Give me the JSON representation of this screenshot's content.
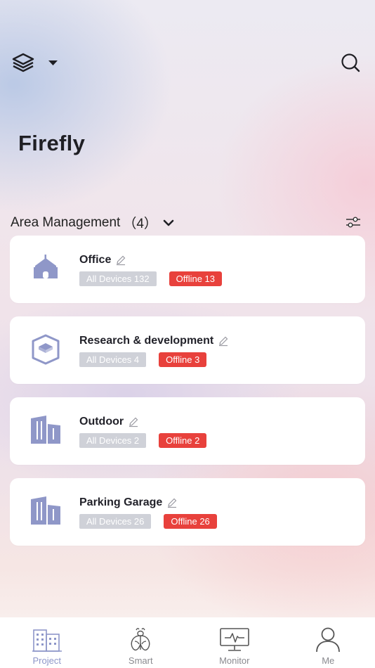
{
  "header": {
    "layers_icon": "layers-icon",
    "dropdown_icon": "caret-down-icon",
    "search_icon": "search-icon"
  },
  "title": "Firefly",
  "area_section": {
    "label": "Area Management",
    "count": "（4）",
    "chevron_icon": "chevron-down-icon",
    "filter_icon": "sliders-icon"
  },
  "areas": [
    {
      "name": "Office",
      "icon": "office-building-icon",
      "all_devices": "All Devices 132",
      "offline": "Offline 13"
    },
    {
      "name": "Research & development",
      "icon": "hexagon-cube-icon",
      "all_devices": "All Devices 4",
      "offline": "Offline 3"
    },
    {
      "name": "Outdoor",
      "icon": "buildings-icon",
      "all_devices": "All Devices 2",
      "offline": "Offline 2"
    },
    {
      "name": "Parking Garage",
      "icon": "buildings-icon",
      "all_devices": "All Devices 26",
      "offline": "Offline 26"
    }
  ],
  "tabs": [
    {
      "label": "Project",
      "icon": "building-icon",
      "active": true
    },
    {
      "label": "Smart",
      "icon": "firefly-icon",
      "active": false
    },
    {
      "label": "Monitor",
      "icon": "monitor-icon",
      "active": false
    },
    {
      "label": "Me",
      "icon": "person-icon",
      "active": false
    }
  ],
  "colors": {
    "accent": "#8d96c9",
    "icon_fill": "#8f97c8",
    "offline": "#e8413c",
    "all_devices": "#cfd1d8"
  }
}
